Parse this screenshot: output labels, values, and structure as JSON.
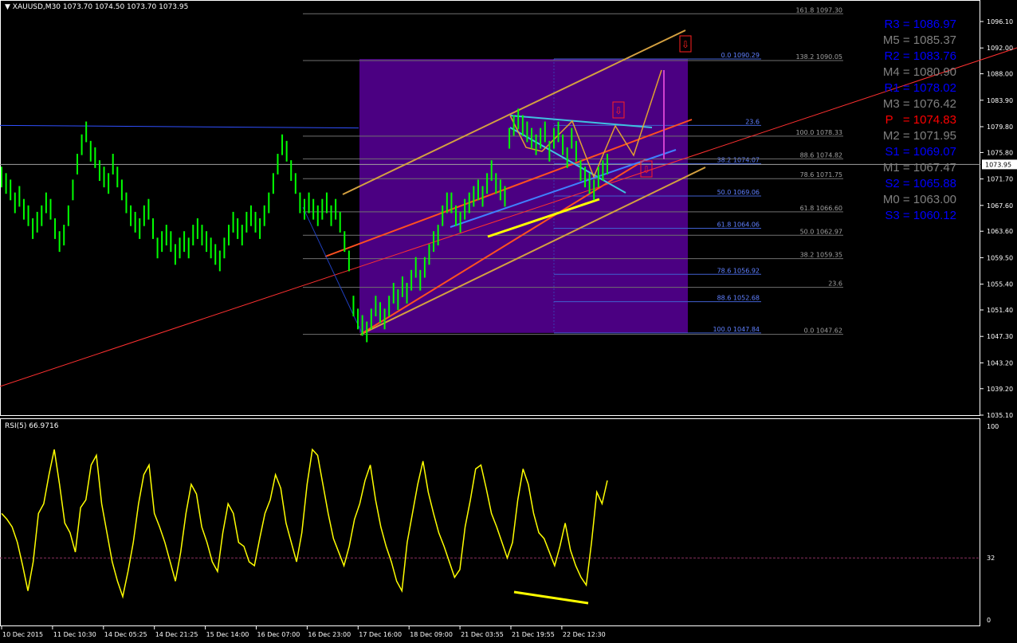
{
  "header": {
    "symbol": "XAUUSD,M30",
    "ohlc": "1073.70 1074.50 1073.70 1073.95"
  },
  "rsi_header": "RSI(5) 66.9716",
  "current_price": "1073.95",
  "colors": {
    "background": "#000000",
    "candles": "#00ff00",
    "rsi": "#ffff00",
    "fib_box": "#4b0082",
    "pivot_blue": "#0000ff",
    "pivot_gray": "#808080",
    "pivot_red": "#ff0000"
  },
  "pivots": [
    {
      "label": "R3 = 1086.97",
      "color": "#0000ff",
      "value": 1086.97
    },
    {
      "label": "M5 = 1085.37",
      "color": "#808080",
      "value": 1085.37
    },
    {
      "label": "R2 = 1083.76",
      "color": "#0000ff",
      "value": 1083.76
    },
    {
      "label": "M4 = 1080.90",
      "color": "#808080",
      "value": 1080.9
    },
    {
      "label": "R1 = 1078.02",
      "color": "#0000ff",
      "value": 1078.02
    },
    {
      "label": "M3 = 1076.42",
      "color": "#808080",
      "value": 1076.42
    },
    {
      "label": "P   = 1074.83",
      "color": "#ff0000",
      "value": 1074.83
    },
    {
      "label": "M2 = 1071.95",
      "color": "#808080",
      "value": 1071.95
    },
    {
      "label": "S1 = 1069.07",
      "color": "#0000ff",
      "value": 1069.07
    },
    {
      "label": "M1 = 1067.47",
      "color": "#808080",
      "value": 1067.47
    },
    {
      "label": "S2 = 1065.88",
      "color": "#0000ff",
      "value": 1065.88
    },
    {
      "label": "M0 = 1063.00",
      "color": "#808080",
      "value": 1063.0
    },
    {
      "label": "S3 = 1060.12",
      "color": "#0000ff",
      "value": 1060.12
    }
  ],
  "chart_data": {
    "type": "line",
    "price_axis_ticks": [
      "1096.10",
      "1092.00",
      "1088.00",
      "1083.90",
      "1079.80",
      "1075.80",
      "1071.70",
      "1067.60",
      "1063.60",
      "1059.50",
      "1055.40",
      "1051.40",
      "1047.30",
      "1043.20",
      "1039.20",
      "1035.10"
    ],
    "price_axis_range": [
      1035.1,
      1096.1
    ],
    "time_labels": [
      "10 Dec 2015",
      "11 Dec 10:30",
      "14 Dec 05:25",
      "14 Dec 21:25",
      "15 Dec 14:00",
      "16 Dec 07:00",
      "16 Dec 23:00",
      "17 Dec 16:00",
      "18 Dec 09:00",
      "21 Dec 03:55",
      "21 Dec 19:55",
      "22 Dec 12:30"
    ],
    "fib_left": [
      {
        "label": "0.0 1090.29",
        "value": 1090.29
      },
      {
        "label": "23.6",
        "value": 1080.0
      },
      {
        "label": "38.2 1074.07",
        "value": 1074.07
      },
      {
        "label": "50.0 1069.06",
        "value": 1069.06
      },
      {
        "label": "61.8 1064.06",
        "value": 1064.06
      },
      {
        "label": "78.6 1056.92",
        "value": 1056.92
      },
      {
        "label": "88.6 1052.68",
        "value": 1052.68
      },
      {
        "label": "100.0 1047.84",
        "value": 1047.84
      }
    ],
    "fib_right": [
      {
        "label": "161.8 1097.30",
        "value": 1097.3
      },
      {
        "label": "138.2 1090.05",
        "value": 1090.05
      },
      {
        "label": "100.0 1078.33",
        "value": 1078.33
      },
      {
        "label": "88.6 1074.82",
        "value": 1074.82
      },
      {
        "label": "78.6 1071.75",
        "value": 1071.75
      },
      {
        "label": "61.8 1066.60",
        "value": 1066.6
      },
      {
        "label": "50.0 1062.97",
        "value": 1062.97
      },
      {
        "label": "38.2 1059.35",
        "value": 1059.35
      },
      {
        "label": "23.6",
        "value": 1054.9
      },
      {
        "label": "0.0 1047.62",
        "value": 1047.62
      }
    ],
    "rsi_axis": [
      "100",
      "32",
      "0"
    ],
    "rsi_range": [
      0,
      100
    ],
    "rsi_level": 32,
    "price_series": [
      1072,
      1071,
      1070,
      1068,
      1069,
      1067,
      1066,
      1064,
      1065,
      1066,
      1068,
      1067,
      1064,
      1062,
      1063,
      1066,
      1070,
      1074,
      1077,
      1079,
      1076,
      1075,
      1073,
      1072,
      1071,
      1074,
      1072,
      1070,
      1068,
      1066,
      1065,
      1064,
      1066,
      1067,
      1064,
      1061,
      1062,
      1063,
      1062,
      1060,
      1061,
      1062,
      1061,
      1063,
      1064,
      1063,
      1062,
      1061,
      1060,
      1059,
      1061,
      1063,
      1065,
      1064,
      1063,
      1065,
      1066,
      1065,
      1064,
      1066,
      1068,
      1071,
      1074,
      1077,
      1076,
      1073,
      1071,
      1068,
      1067,
      1068,
      1067,
      1066,
      1067,
      1068,
      1066,
      1067,
      1065,
      1062,
      1059,
      1052,
      1050,
      1049,
      1048,
      1050,
      1052,
      1051,
      1050,
      1052,
      1054,
      1053,
      1055,
      1054,
      1056,
      1058,
      1056,
      1058,
      1060,
      1062,
      1063,
      1066,
      1068,
      1068,
      1066,
      1065,
      1067,
      1068,
      1069,
      1070,
      1069,
      1071,
      1073,
      1071,
      1070,
      1069,
      1078,
      1080,
      1081,
      1080,
      1079,
      1078,
      1077,
      1078,
      1079,
      1076,
      1078,
      1079,
      1077,
      1075,
      1078,
      1076,
      1073,
      1072,
      1071,
      1070,
      1072,
      1073,
      1074
    ],
    "rsi_series": [
      55,
      52,
      48,
      40,
      28,
      15,
      30,
      55,
      60,
      75,
      88,
      70,
      50,
      45,
      35,
      58,
      62,
      80,
      85,
      60,
      45,
      30,
      20,
      12,
      25,
      40,
      60,
      75,
      80,
      55,
      48,
      40,
      30,
      20,
      35,
      55,
      70,
      65,
      48,
      40,
      30,
      25,
      45,
      60,
      55,
      40,
      38,
      30,
      28,
      42,
      55,
      62,
      75,
      68,
      50,
      40,
      30,
      45,
      70,
      88,
      85,
      70,
      55,
      42,
      35,
      28,
      38,
      52,
      60,
      72,
      80,
      62,
      48,
      38,
      30,
      20,
      15,
      40,
      55,
      70,
      82,
      66,
      55,
      45,
      38,
      30,
      22,
      26,
      48,
      62,
      78,
      80,
      68,
      55,
      48,
      40,
      32,
      40,
      62,
      78,
      70,
      55,
      45,
      42,
      35,
      28,
      38,
      50,
      36,
      28,
      22,
      18,
      40,
      66,
      60,
      72
    ]
  }
}
